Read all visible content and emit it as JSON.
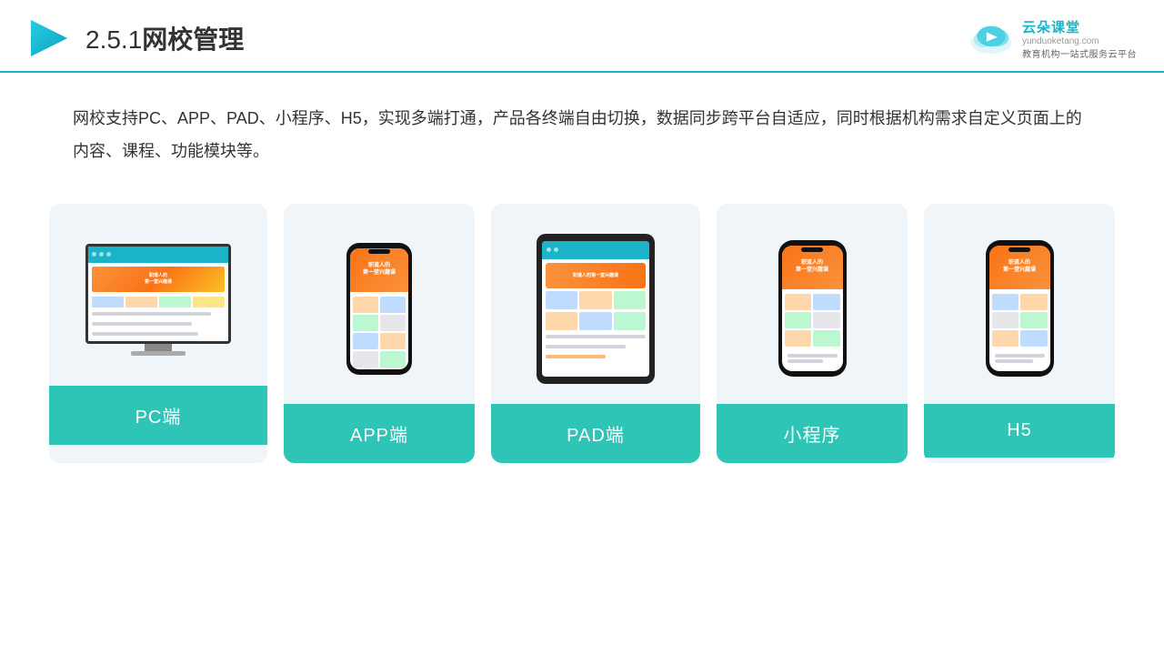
{
  "header": {
    "section_number": "2.5.1",
    "title": "网校管理",
    "border_color": "#1ab3c8"
  },
  "logo": {
    "name": "云朵课堂",
    "url": "yunduoketang.com",
    "slogan": "教育机构一站式服务云平台"
  },
  "description": "网校支持PC、APP、PAD、小程序、H5，实现多端打通，产品各终端自由切换，数据同步跨平台自适应，同时根据机构需求自定义页面上的内容、课程、功能模块等。",
  "cards": [
    {
      "id": "pc",
      "label": "PC端",
      "type": "pc"
    },
    {
      "id": "app",
      "label": "APP端",
      "type": "phone"
    },
    {
      "id": "pad",
      "label": "PAD端",
      "type": "tablet"
    },
    {
      "id": "miniapp",
      "label": "小程序",
      "type": "phone"
    },
    {
      "id": "h5",
      "label": "H5",
      "type": "phone"
    }
  ],
  "accent_color": "#2ec4b6"
}
